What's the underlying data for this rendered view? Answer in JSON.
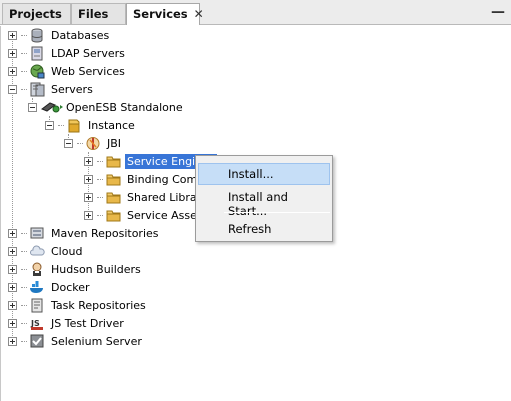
{
  "tabs": {
    "projects": "Projects",
    "files": "Files",
    "services": "Services",
    "close_glyph": "✕",
    "minimize_glyph": "—"
  },
  "tree": {
    "databases": "Databases",
    "ldap": "LDAP Servers",
    "web_services": "Web Services",
    "servers": "Servers",
    "openesb": "OpenESB Standalone",
    "instance": "Instance",
    "jbi": "JBI",
    "service_engines": "Service Engines",
    "binding_components": "Binding Compon",
    "shared_libraries": "Shared Librarie",
    "service_assemblies": "Service Assemb",
    "maven": "Maven Repositories",
    "cloud": "Cloud",
    "hudson": "Hudson Builders",
    "docker": "Docker",
    "task_repos": "Task Repositories",
    "js_test": "JS Test Driver",
    "selenium": "Selenium Server"
  },
  "context_menu": {
    "install": "Install...",
    "install_start": "Install and Start...",
    "refresh": "Refresh"
  },
  "colors": {
    "selection": "#3875d7",
    "menu_hover": "#c6def7",
    "folder": "#e8b84a"
  }
}
